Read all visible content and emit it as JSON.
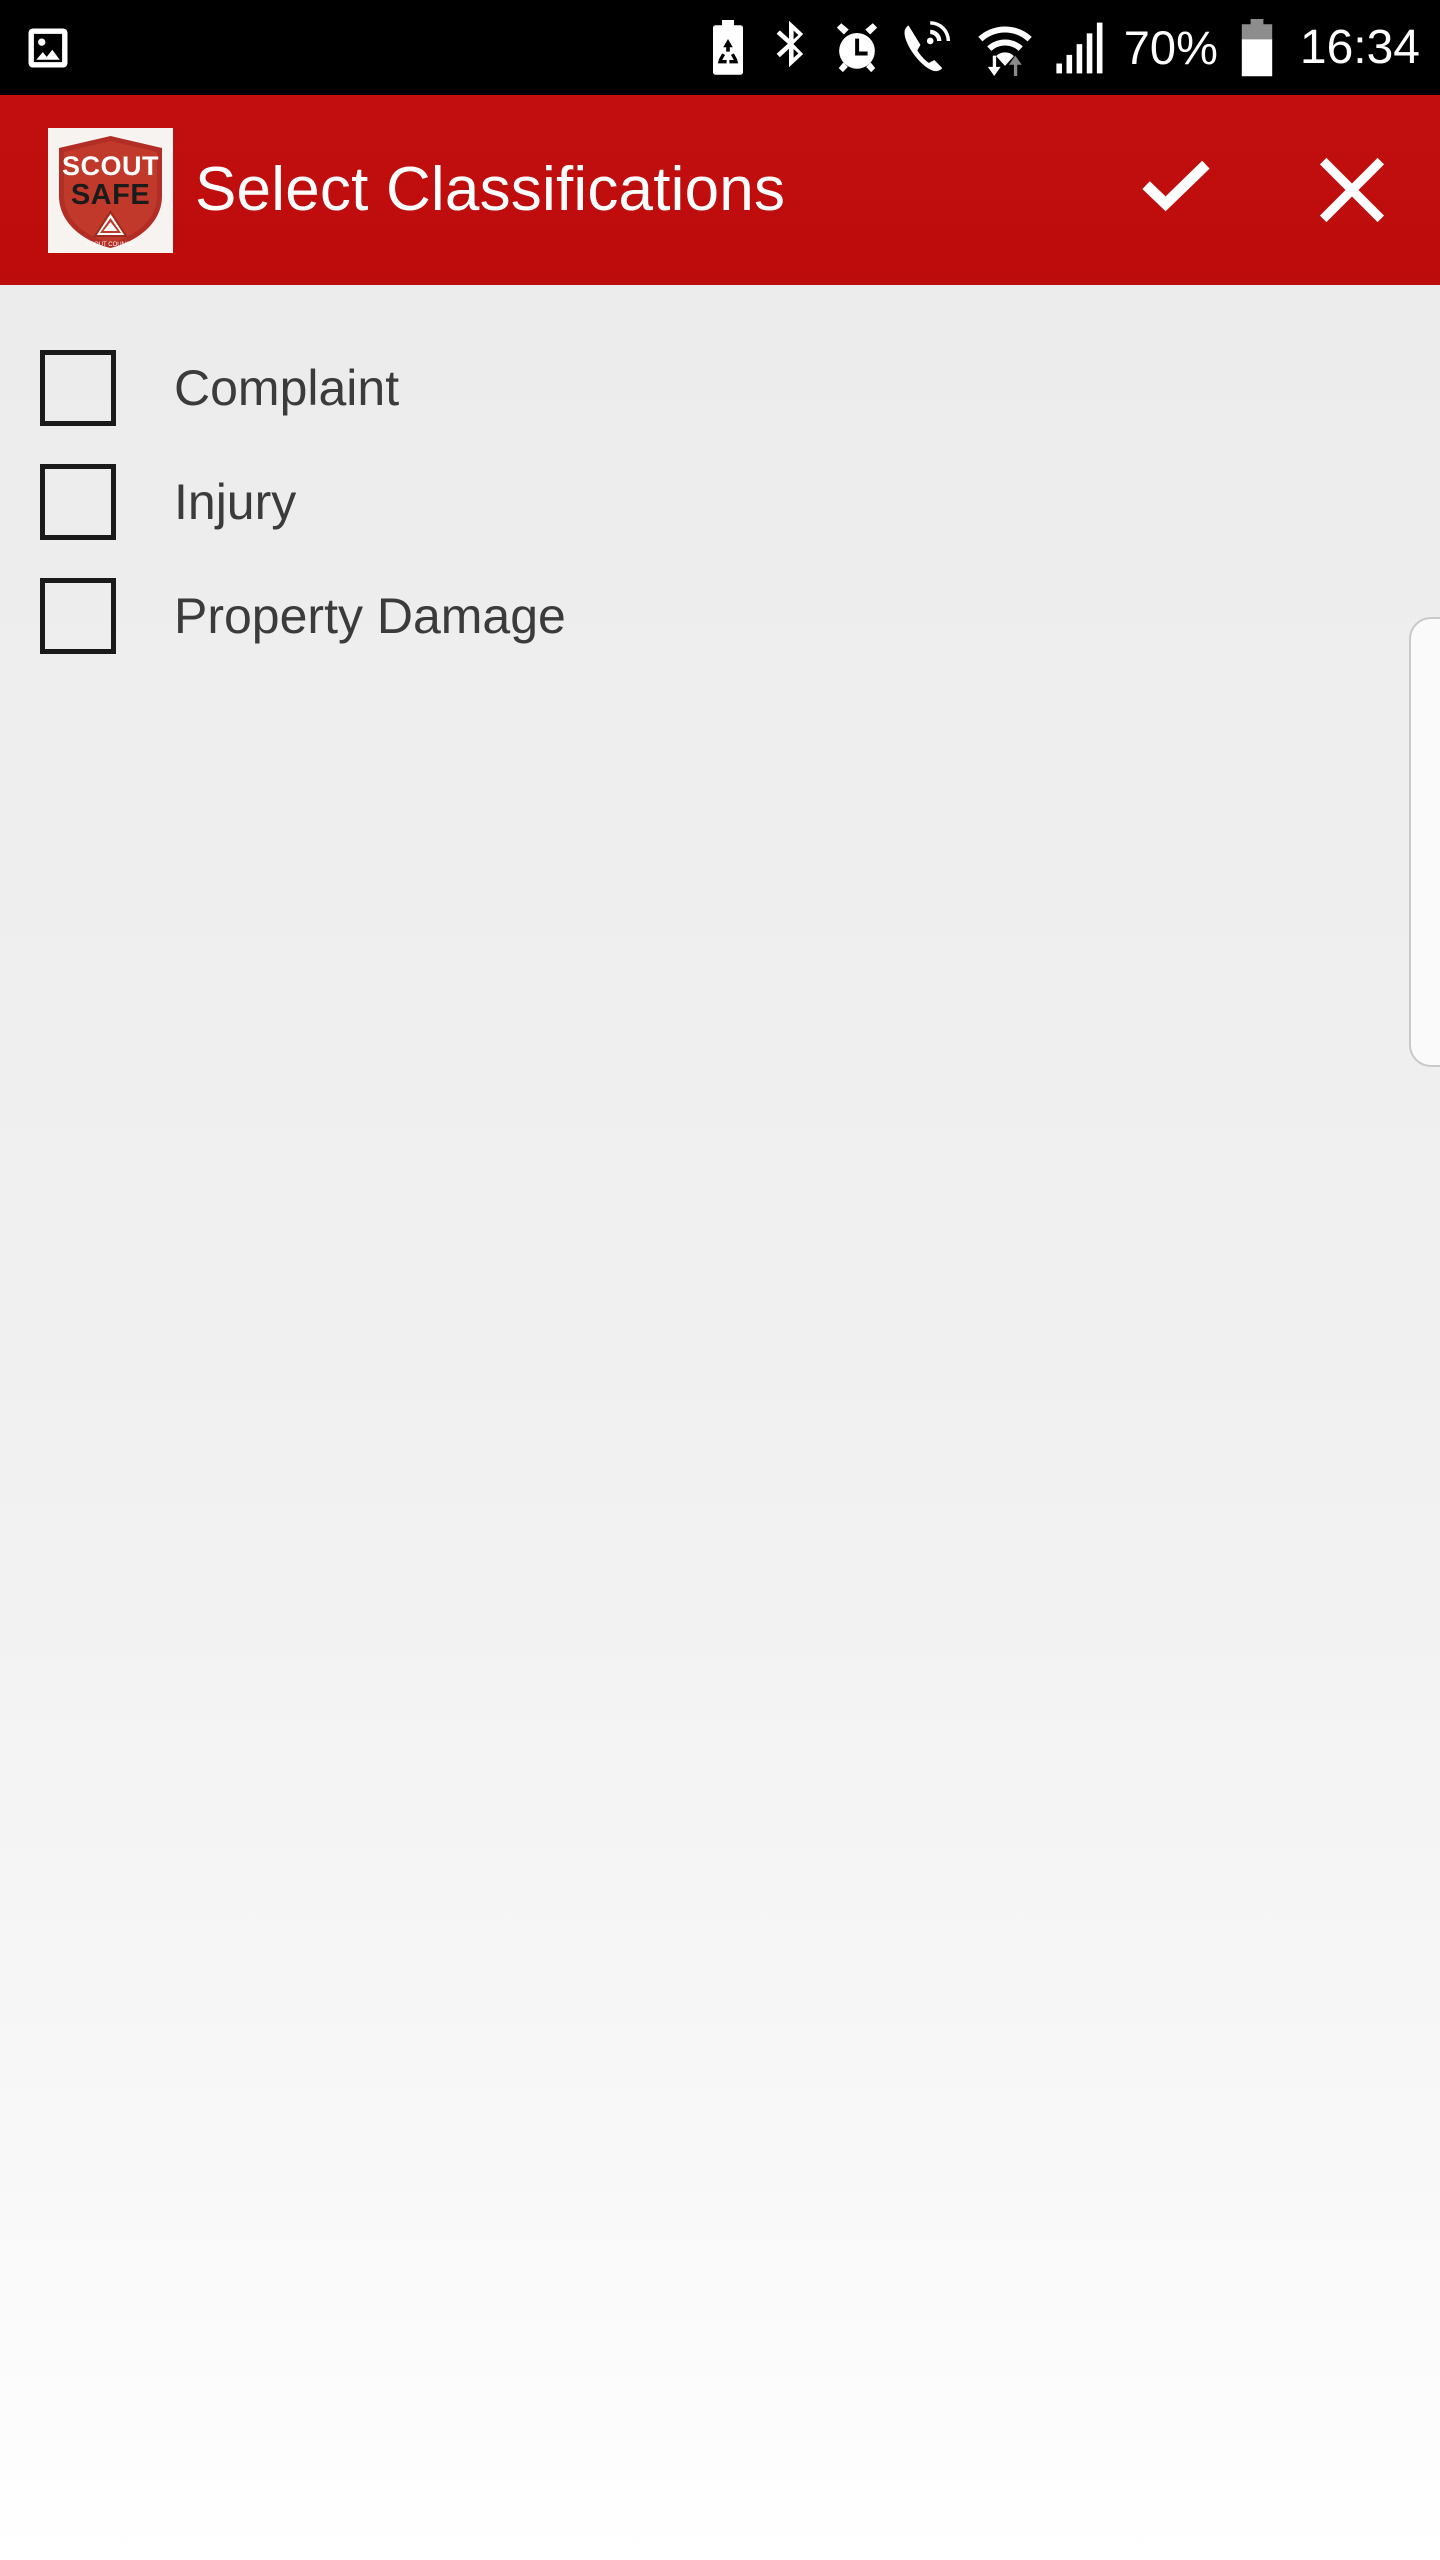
{
  "status_bar": {
    "background": "#000000",
    "left_icons": [
      {
        "name": "image-notification-icon",
        "glyph": "image"
      }
    ],
    "right_icons": [
      {
        "name": "battery-saver-icon",
        "glyph": "battery-recycle"
      },
      {
        "name": "bluetooth-icon",
        "glyph": "bluetooth"
      },
      {
        "name": "alarm-clock-icon",
        "glyph": "alarm"
      },
      {
        "name": "wifi-calling-icon",
        "glyph": "phone-signal"
      },
      {
        "name": "wifi-data-icon",
        "glyph": "wifi-arrows"
      },
      {
        "name": "cellular-signal-icon",
        "glyph": "signal-bars"
      }
    ],
    "battery_percent": "70%",
    "clock": "16:34"
  },
  "action_bar": {
    "background": "#C00D0D",
    "logo": {
      "name": "scout-safe-logo",
      "line1": "SCOUT",
      "line2": "SAFE"
    },
    "title": "Select Classifications",
    "confirm_label": "✓",
    "cancel_label": "✕",
    "confirm_name": "confirm-check-icon",
    "cancel_name": "cancel-close-icon"
  },
  "content": {
    "background": "#EDEDED",
    "items": [
      {
        "label": "Complaint",
        "checked": false
      },
      {
        "label": "Injury",
        "checked": false
      },
      {
        "label": "Property Damage",
        "checked": false
      }
    ]
  }
}
